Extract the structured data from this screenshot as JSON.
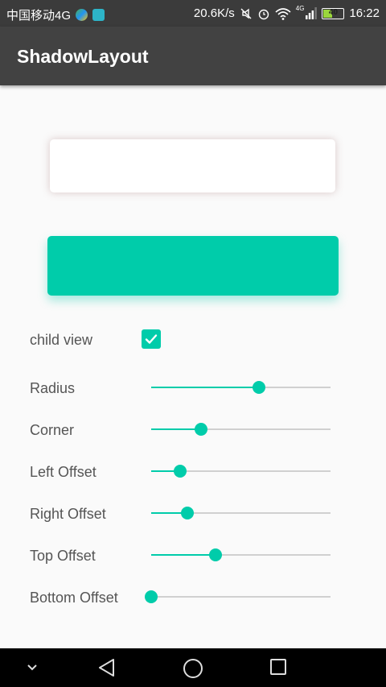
{
  "status_bar": {
    "carrier": "中国移动4G",
    "speed": "20.6K/s",
    "network_type": "4G",
    "battery": "40",
    "time": "16:22"
  },
  "app_bar": {
    "title": "ShadowLayout"
  },
  "colors": {
    "accent": "#00ccaa",
    "appbar": "#424242",
    "statusbar": "#3b3b3b"
  },
  "child_view": {
    "label": "child view",
    "checked": true
  },
  "sliders": [
    {
      "label": "Radius",
      "value": 0.6
    },
    {
      "label": "Corner",
      "value": 0.28
    },
    {
      "label": "Left Offset",
      "value": 0.16
    },
    {
      "label": "Right Offset",
      "value": 0.2
    },
    {
      "label": "Top Offset",
      "value": 0.36
    },
    {
      "label": "Bottom Offset",
      "value": 0.0
    }
  ],
  "nav_bar": {
    "icons": [
      "chevron-down-icon",
      "back-icon",
      "home-icon",
      "recents-icon"
    ]
  }
}
